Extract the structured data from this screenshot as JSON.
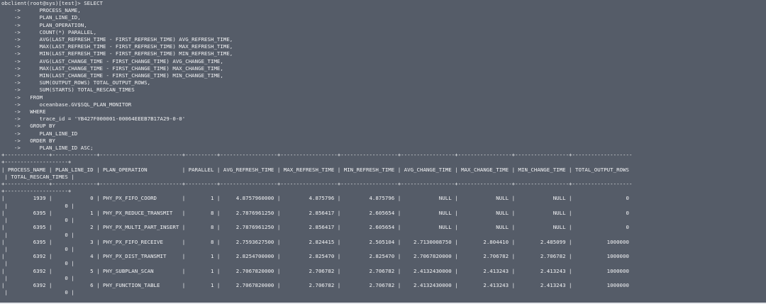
{
  "terminal": {
    "lines": [
      "obclient(root@sys)[test]> SELECT",
      "    ->      PROCESS_NAME,",
      "    ->      PLAN_LINE_ID,",
      "    ->      PLAN_OPERATION,",
      "    ->      COUNT(*) PARALLEL,",
      "    ->      AVG(LAST_REFRESH_TIME - FIRST_REFRESH_TIME) AVG_REFRESH_TIME,",
      "    ->      MAX(LAST_REFRESH_TIME - FIRST_REFRESH_TIME) MAX_REFRESH_TIME,",
      "    ->      MIN(LAST_REFRESH_TIME - FIRST_REFRESH_TIME) MIN_REFRESH_TIME,",
      "    ->      AVG(LAST_CHANGE_TIME - FIRST_CHANGE_TIME) AVG_CHANGE_TIME,",
      "    ->      MAX(LAST_CHANGE_TIME - FIRST_CHANGE_TIME) MAX_CHANGE_TIME,",
      "    ->      MIN(LAST_CHANGE_TIME - FIRST_CHANGE_TIME) MIN_CHANGE_TIME,",
      "    ->      SUM(OUTPUT_ROWS) TOTAL_OUTPUT_ROWS,",
      "    ->      SUM(STARTS) TOTAL_RESCAN_TIMES",
      "    ->   FROM",
      "    ->      oceanbase.GV$SQL_PLAN_MONITOR",
      "    ->   WHERE",
      "    ->      trace_id = 'YB427F000001-00064EEEB7B17A29-0-0'",
      "    ->   GROUP BY",
      "    ->      PLAN_LINE_ID",
      "    ->   ORDER BY",
      "    ->      PLAN_LINE_ID ASC;",
      "+--------------+--------------+--------------------------+----------+------------------+------------------+------------------+-----------------+-----------------+-----------------+-------------------",
      "+--------------------+",
      "| PROCESS_NAME | PLAN_LINE_ID | PLAN_OPERATION           | PARALLEL | AVG_REFRESH_TIME | MAX_REFRESH_TIME | MIN_REFRESH_TIME | AVG_CHANGE_TIME | MAX_CHANGE_TIME | MIN_CHANGE_TIME | TOTAL_OUTPUT_ROWS",
      " | TOTAL_RESCAN_TIMES |",
      "+--------------+--------------+--------------------------+----------+------------------+------------------+------------------+-----------------+-----------------+-----------------+-------------------",
      "+--------------------+",
      "|         1939 |            0 | PHY_PX_FIFO_COORD        |        1 |     4.8757960000 |         4.875796 |         4.875796 |            NULL |            NULL |            NULL |                 0",
      " |                  0 |",
      "|         6395 |            1 | PHY_PX_REDUCE_TRANSMIT   |        8 |     2.7876961250 |         2.856417 |         2.605654 |            NULL |            NULL |            NULL |                 0",
      " |                  0 |",
      "|         6395 |            2 | PHY_PX_MULTI_PART_INSERT |        8 |     2.7876961250 |         2.856417 |         2.605654 |            NULL |            NULL |            NULL |                 0",
      " |                  0 |",
      "|         6395 |            3 | PHY_PX_FIFO_RECEIVE      |        8 |     2.7593627500 |         2.824415 |         2.505104 |    2.7130008750 |        2.804410 |        2.485099 |           1000000",
      " |                  0 |",
      "|         6392 |            4 | PHY_PX_DIST_TRANSMIT     |        1 |     2.8254700000 |         2.825470 |         2.825470 |    2.7067820000 |        2.706782 |        2.706782 |           1000000",
      " |                  0 |",
      "|         6392 |            5 | PHY_SUBPLAN_SCAN         |        1 |     2.7067820000 |         2.706782 |         2.706782 |    2.4132430000 |        2.413243 |        2.413243 |           1000000",
      " |                  0 |",
      "|         6392 |            6 | PHY_FUNCTION_TABLE       |        1 |     2.7067820000 |         2.706782 |         2.706782 |    2.4132430000 |        2.413243 |        2.413243 |           1000000",
      " |                  0 |"
    ]
  }
}
